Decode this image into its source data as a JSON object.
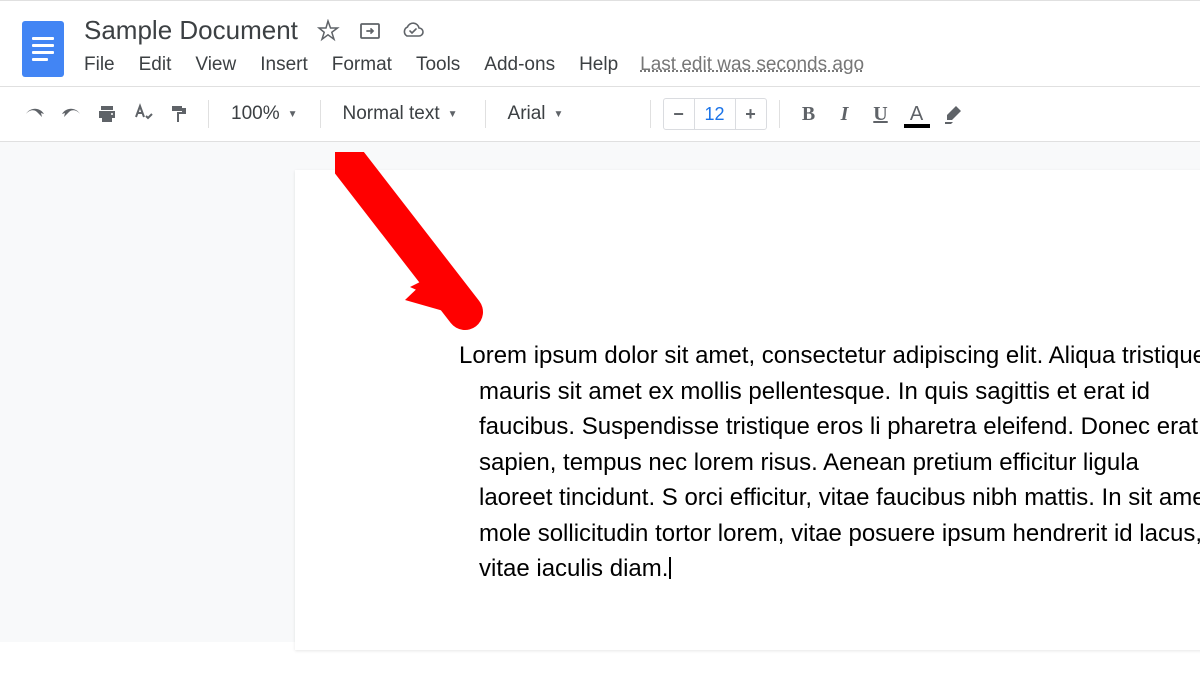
{
  "header": {
    "title": "Sample Document",
    "last_edit": "Last edit was seconds ago"
  },
  "menu": {
    "file": "File",
    "edit": "Edit",
    "view": "View",
    "insert": "Insert",
    "format": "Format",
    "tools": "Tools",
    "addons": "Add-ons",
    "help": "Help"
  },
  "toolbar": {
    "zoom": "100%",
    "style": "Normal text",
    "font": "Arial",
    "font_size": "12",
    "minus": "−",
    "plus": "+",
    "bold": "B",
    "italic": "I",
    "underline": "U",
    "text_color": "A"
  },
  "document": {
    "body": "Lorem ipsum dolor sit amet, consectetur adipiscing elit. Aliqua tristique mauris sit amet ex mollis pellentesque. In quis sagittis et erat id faucibus. Suspendisse tristique eros li pharetra eleifend. Donec erat sapien, tempus nec lorem risus. Aenean pretium efficitur ligula laoreet tincidunt. S orci efficitur, vitae faucibus nibh mattis. In sit amet mole sollicitudin tortor lorem, vitae posuere ipsum hendrerit id lacus, vitae iaculis diam."
  }
}
